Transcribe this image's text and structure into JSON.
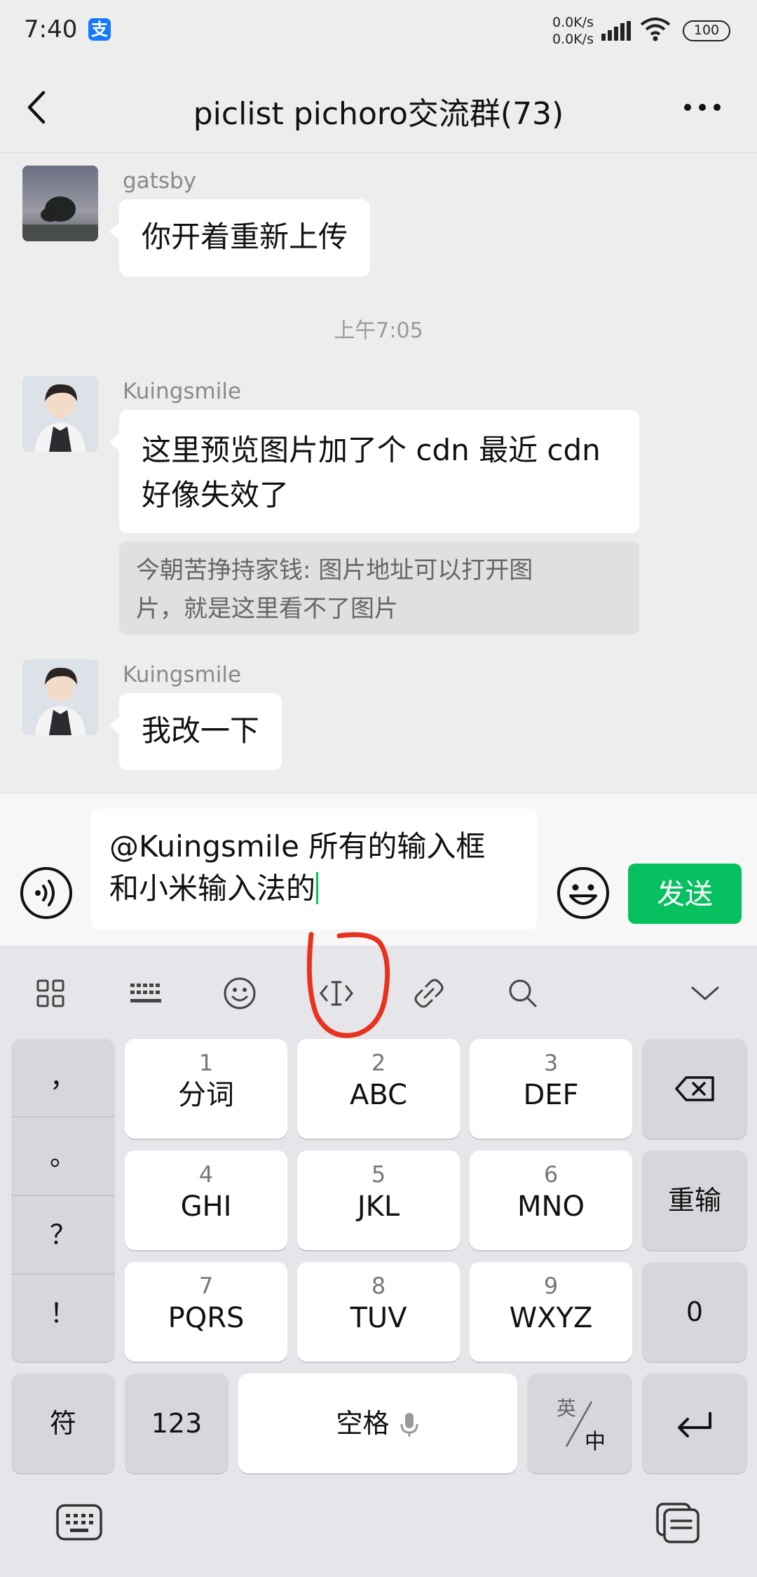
{
  "status_bar": {
    "time": "7:40",
    "app_badge": "支",
    "net_up": "0.0K/s",
    "net_down": "0.0K/s",
    "battery": "100"
  },
  "header": {
    "title": "piclist pichoro交流群(73)"
  },
  "messages": [
    {
      "sender": "gatsby",
      "text": "你开着重新上传"
    },
    {
      "timestamp": "上午7:05"
    },
    {
      "sender": "Kuingsmile",
      "text_line1": "这里预览图片加了个 cdn 最近 cdn",
      "text_line2": "好像失效了",
      "quote_line1": "今朝苦挣持家钱: 图片地址可以打开图",
      "quote_line2": "片，就是这里看不了图片"
    },
    {
      "sender": "Kuingsmile",
      "text": "我改一下"
    }
  ],
  "input": {
    "line1": "@Kuingsmile 所有的输入框",
    "line2": "和小米输入法的",
    "send_label": "发送"
  },
  "keyboard": {
    "toolbar_icons": [
      "grid-icon",
      "keyboard-icon",
      "emoji-icon",
      "cursor-icon",
      "link-icon",
      "search-icon",
      "chevron-down-icon"
    ],
    "punctuation": [
      "，",
      "。",
      "？",
      "！"
    ],
    "keys": [
      {
        "num": "1",
        "label": "分词"
      },
      {
        "num": "2",
        "label": "ABC"
      },
      {
        "num": "3",
        "label": "DEF"
      },
      {
        "num": "4",
        "label": "GHI"
      },
      {
        "num": "5",
        "label": "JKL"
      },
      {
        "num": "6",
        "label": "MNO"
      },
      {
        "num": "7",
        "label": "PQRS"
      },
      {
        "num": "8",
        "label": "TUV"
      },
      {
        "num": "9",
        "label": "WXYZ"
      }
    ],
    "reenter": "重输",
    "zero": "0",
    "symbols": "符",
    "numbers": "123",
    "space": "空格",
    "lang_en": "英",
    "lang_zh": "中"
  },
  "colors": {
    "accent_green": "#07c160",
    "annotation_red": "#e8321e"
  }
}
